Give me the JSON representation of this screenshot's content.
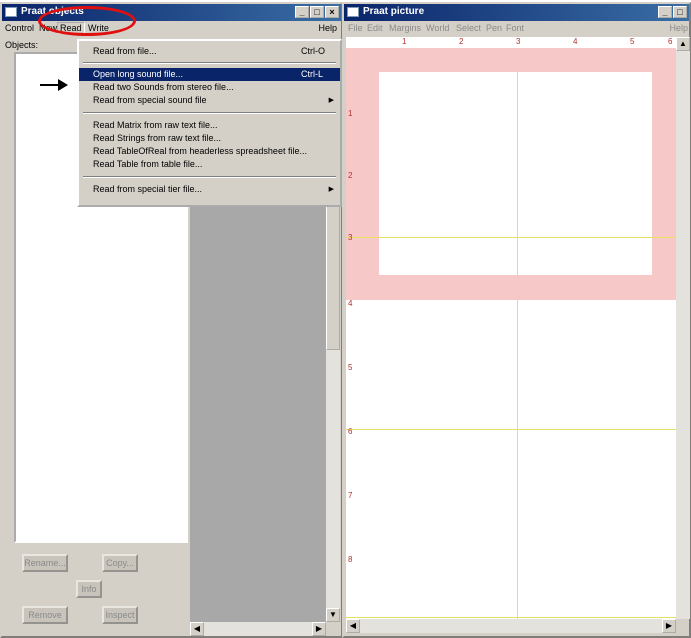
{
  "objects_window": {
    "title": "Praat objects",
    "menus": [
      "Control",
      "New",
      "Read",
      "Write"
    ],
    "help": "Help",
    "objects_label": "Objects:",
    "buttons": {
      "rename": "Rename...",
      "copy": "Copy...",
      "info": "Info",
      "remove": "Remove",
      "inspect": "Inspect"
    }
  },
  "read_menu": {
    "items": [
      {
        "label": "Read from file...",
        "shortcut": "Ctrl-O"
      },
      {
        "label": "Open long sound file...",
        "shortcut": "Ctrl-L"
      },
      {
        "label": "Read two Sounds from stereo file...",
        "shortcut": ""
      },
      {
        "label": "Read from special sound file",
        "shortcut": ""
      },
      {
        "label": "Read Matrix from raw text file...",
        "shortcut": ""
      },
      {
        "label": "Read Strings from raw text file...",
        "shortcut": ""
      },
      {
        "label": "Read TableOfReal from headerless spreadsheet file...",
        "shortcut": ""
      },
      {
        "label": "Read Table from table file...",
        "shortcut": ""
      },
      {
        "label": "Read from special tier file...",
        "shortcut": ""
      }
    ]
  },
  "picture_window": {
    "title": "Praat picture",
    "menus": [
      "File",
      "Edit",
      "Margins",
      "World",
      "Select",
      "Pen",
      "Font"
    ],
    "help": "Help",
    "ruler_top": [
      "1",
      "2",
      "3",
      "4",
      "5",
      "6"
    ],
    "ruler_left": [
      "1",
      "2",
      "3",
      "4",
      "5",
      "6",
      "7",
      "8"
    ]
  },
  "colors": {
    "title_bar": "#0a246a",
    "menu_highlight": "#0a246a",
    "selection_pink": "#f7c8c8",
    "guide_yellow": "#e8e060",
    "annotation_red": "#e01010"
  }
}
